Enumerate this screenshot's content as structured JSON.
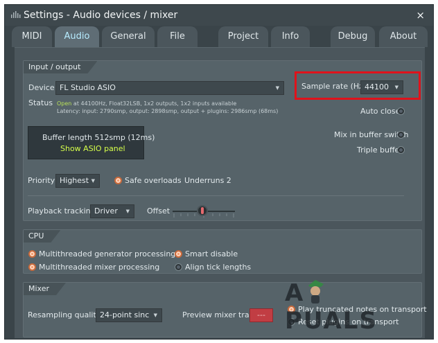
{
  "window": {
    "title": "Settings - Audio devices / mixer",
    "close_glyph": "×"
  },
  "tabs": [
    {
      "label": "MIDI",
      "active": false
    },
    {
      "label": "Audio",
      "active": true
    },
    {
      "label": "General",
      "active": false
    },
    {
      "label": "File",
      "active": false
    },
    {
      "label": "Project",
      "active": false
    },
    {
      "label": "Info",
      "active": false
    },
    {
      "label": "Debug",
      "active": false
    },
    {
      "label": "About",
      "active": false
    }
  ],
  "io": {
    "section_label": "Input / output",
    "device_label": "Device",
    "device_value": "FL Studio ASIO",
    "sample_rate_label": "Sample rate (Hz)",
    "sample_rate_value": "44100",
    "status_label": "Status",
    "status_open": "Open",
    "status_line1_rest": " at 44100Hz, Float32LSB, 1x2 outputs, 1x2 inputs available",
    "status_line2": "Latency: input: 2790smp, output: 2898smp, output + plugins: 2986smp (68ms)",
    "auto_close_label": "Auto close",
    "buffer_length": "Buffer length 512smp (12ms)",
    "show_asio_panel": "Show ASIO panel",
    "mix_in_buffer_label": "Mix in buffer switch",
    "triple_buffer_label": "Triple buffer",
    "priority_label": "Priority",
    "priority_value": "Highest",
    "safe_overloads_label": "Safe overloads",
    "underruns": "Underruns 2",
    "playback_tracking_label": "Playback tracking",
    "playback_tracking_value": "Driver",
    "offset_label": "Offset"
  },
  "cpu": {
    "section_label": "CPU",
    "multi_gen_label": "Multithreaded generator processing",
    "multi_mixer_label": "Multithreaded mixer processing",
    "smart_disable_label": "Smart disable",
    "align_tick_label": "Align tick lengths"
  },
  "mixer": {
    "section_label": "Mixer",
    "resampling_label": "Resampling quality",
    "resampling_value": "24-point sinc",
    "preview_label": "Preview mixer track",
    "preview_value": "---",
    "play_truncated_label": "Play truncated notes on transport",
    "reset_plugins_label": "Reset plugins on transport"
  },
  "watermark": {
    "text": "A  PUALS"
  },
  "colors": {
    "accent_active_tab": "#b7ecff",
    "status_open": "#b8e05a",
    "asio_link": "#d6ff4a",
    "radio_on": "#f39b6c",
    "highlight_box": "#e0121b",
    "preview_button": "#c13d43"
  }
}
